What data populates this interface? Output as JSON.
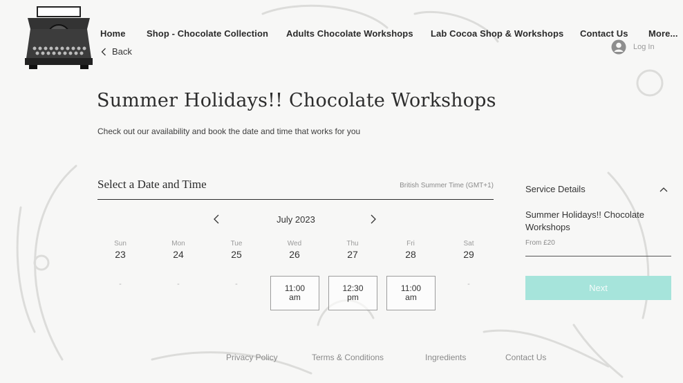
{
  "nav": {
    "items": [
      {
        "label": "Home"
      },
      {
        "label": "Shop - Chocolate Collection"
      },
      {
        "label": "Adults Chocolate Workshops"
      },
      {
        "label": "Lab Cocoa Shop & Workshops"
      },
      {
        "label": "Contact Us"
      },
      {
        "label": "More..."
      }
    ],
    "back_label": "Back",
    "login_label": "Log In"
  },
  "page": {
    "title": "Summer Holidays!! Chocolate Workshops",
    "subtitle": "Check out our availability and book the date and time that works for you"
  },
  "scheduler": {
    "section_title": "Select a Date and Time",
    "timezone": "British Summer Time (GMT+1)",
    "month": "July 2023",
    "days": [
      {
        "name": "Sun",
        "num": "23"
      },
      {
        "name": "Mon",
        "num": "24"
      },
      {
        "name": "Tue",
        "num": "25"
      },
      {
        "name": "Wed",
        "num": "26"
      },
      {
        "name": "Thu",
        "num": "27"
      },
      {
        "name": "Fri",
        "num": "28"
      },
      {
        "name": "Sat",
        "num": "29"
      }
    ],
    "no_slot_mark": "-",
    "slots": [
      {
        "day": "Wed",
        "time": "11:00 am"
      },
      {
        "day": "Thu",
        "time": "12:30 pm"
      },
      {
        "day": "Fri",
        "time": "11:00 am"
      }
    ]
  },
  "service": {
    "title": "Service Details",
    "name": "Summer Holidays!! Chocolate Workshops",
    "price": "From £20",
    "next_label": "Next",
    "button_color": "#a6e4db"
  },
  "footer": {
    "links": [
      {
        "label": "Privacy Policy"
      },
      {
        "label": "Terms & Conditions"
      },
      {
        "label": "Ingredients"
      },
      {
        "label": "Contact Us"
      }
    ]
  },
  "icons": {
    "logo": "typewriter-logo",
    "back": "chevron-left-icon",
    "avatar": "user-avatar-icon",
    "prev": "chevron-left-icon",
    "next": "chevron-right-icon",
    "collapse": "chevron-up-icon"
  }
}
